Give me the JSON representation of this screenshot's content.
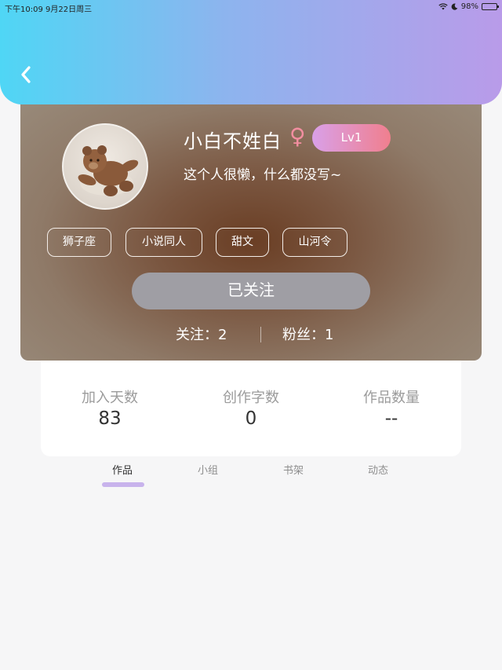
{
  "status_bar": {
    "time_date": "下午10:09   9月22日周三",
    "battery_percent": "98%",
    "battery_level": 0.98
  },
  "header": {
    "back_icon": "chevron-left-icon",
    "gradient_colors": [
      "#4fd6f5",
      "#8db4ee",
      "#b99be9"
    ]
  },
  "profile": {
    "name": "小白不姓白",
    "gender_symbol": "♀",
    "level": "Lv1",
    "bio": "这个人很懒，什么都没写~",
    "tags": [
      "狮子座",
      "小说同人",
      "甜文",
      "山河令"
    ],
    "follow_button": "已关注",
    "following": "关注：2",
    "fans": "粉丝：1"
  },
  "numbers": [
    {
      "label": "加入天数",
      "value": "83"
    },
    {
      "label": "创作字数",
      "value": "0"
    },
    {
      "label": "作品数量",
      "value": "--"
    }
  ],
  "tabs": [
    {
      "label": "作品",
      "active": true
    },
    {
      "label": "小组",
      "active": false
    },
    {
      "label": "书架",
      "active": false
    },
    {
      "label": "动态",
      "active": false
    }
  ],
  "colors": {
    "accent": "#c8b3ec",
    "level_badge": [
      "#d9a0e8",
      "#f07f8e"
    ],
    "gender": "#f28ea0",
    "follow_button": "#9f9ea4"
  }
}
